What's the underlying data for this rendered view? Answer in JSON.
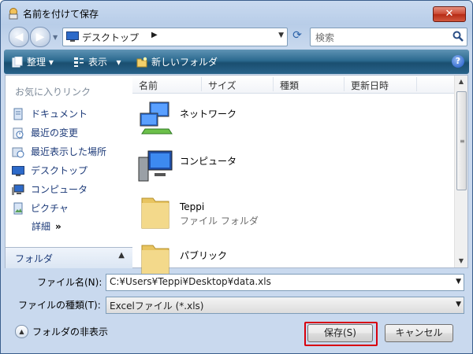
{
  "window": {
    "title": "名前を付けて保存",
    "close_glyph": "✕"
  },
  "nav": {
    "location": "デスクトップ",
    "search_placeholder": "検索"
  },
  "toolbar": {
    "organize": "整理",
    "views": "表示",
    "new_folder": "新しいフォルダ",
    "help": "?"
  },
  "sidebar": {
    "title": "お気に入りリンク",
    "items": [
      {
        "label": "ドキュメント",
        "icon": "documents-icon"
      },
      {
        "label": "最近の変更",
        "icon": "recent-changes-icon"
      },
      {
        "label": "最近表示した場所",
        "icon": "recent-places-icon"
      },
      {
        "label": "デスクトップ",
        "icon": "desktop-icon"
      },
      {
        "label": "コンピュータ",
        "icon": "computer-icon"
      },
      {
        "label": "ピクチャ",
        "icon": "pictures-icon"
      }
    ],
    "details": "詳細",
    "folders": "フォルダ"
  },
  "files": {
    "columns": [
      "名前",
      "サイズ",
      "種類",
      "更新日時"
    ],
    "items": [
      {
        "name": "ネットワーク",
        "sub": "",
        "icon": "network-icon"
      },
      {
        "name": "コンピュータ",
        "sub": "",
        "icon": "computer-icon"
      },
      {
        "name": "Teppi",
        "sub": "ファイル フォルダ",
        "icon": "folder-icon"
      },
      {
        "name": "パブリック",
        "sub": "",
        "icon": "folder-icon"
      }
    ]
  },
  "form": {
    "filename_label": "ファイル名(N):",
    "filename_value": "C:¥Users¥Teppi¥Desktop¥data.xls",
    "filetype_label": "ファイルの種類(T):",
    "filetype_value": "Excelファイル (*.xls)"
  },
  "footer": {
    "hide_folders": "フォルダの非表示",
    "save": "保存(S)",
    "cancel": "キャンセル"
  }
}
